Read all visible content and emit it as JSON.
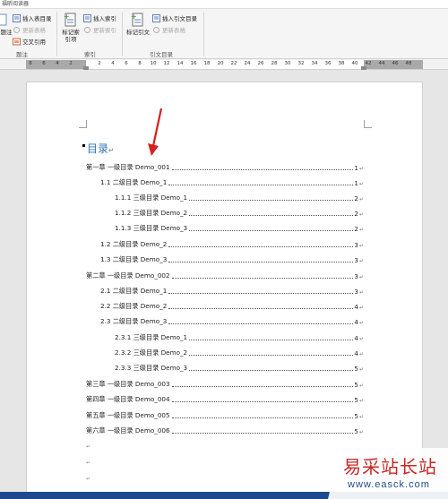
{
  "ribbon": {
    "tab_label": "福昕阅读器",
    "left_cut_label": "题注",
    "groups": {
      "caption_label": "题注",
      "index_label": "索引",
      "citation_label": "引文目录"
    },
    "buttons": {
      "insert_table_of_figures": "插入表目录",
      "update_table": "更新表格",
      "cross_reference": "交叉引用",
      "mark_entry": "标记索引项",
      "insert_index": "插入索引",
      "update_index": "更新索引",
      "mark_citation": "标记引文",
      "insert_table_of_authorities": "插入引文目录",
      "update_table_auth": "更新表格"
    }
  },
  "ruler": {
    "ticks": [
      "8",
      "6",
      "4",
      "2",
      "2",
      "4",
      "6",
      "8",
      "10",
      "12",
      "14",
      "16",
      "18",
      "20",
      "22",
      "24",
      "26",
      "28",
      "30",
      "32",
      "34",
      "36",
      "38",
      "40",
      "42",
      "44",
      "46",
      "48"
    ]
  },
  "document": {
    "toc_title": "目录",
    "paragraph_mark": "↵",
    "entries": [
      {
        "text": "第一章  一级目录 Demo_001",
        "page": "1"
      },
      {
        "text": "1.1  二级目录 Demo_1",
        "page": "1"
      },
      {
        "text": "1.1.1  三级目录 Demo_1",
        "page": "2"
      },
      {
        "text": "1.1.2  三级目录 Demo_2",
        "page": "2"
      },
      {
        "text": "1.1.3  三级目录 Demo_3",
        "page": "2"
      },
      {
        "text": "1.2  二级目录 Demo_2",
        "page": "3"
      },
      {
        "text": "1.3  二级目录 Demo_3",
        "page": "3"
      },
      {
        "text": "第二章  一级目录 Demo_002",
        "page": "3"
      },
      {
        "text": "2.1  二级目录 Demo_1",
        "page": "3"
      },
      {
        "text": "2.2  二级目录 Demo_2",
        "page": "4"
      },
      {
        "text": "2.3  二级目录 Demo_3",
        "page": "4"
      },
      {
        "text": "2.3.1  三级目录 Demo_1",
        "page": "4"
      },
      {
        "text": "2.3.2  三级目录 Demo_2",
        "page": "4"
      },
      {
        "text": "2.3.3  三级目录 Demo_3",
        "page": "5"
      },
      {
        "text": "第三章  一级目录 Demo_003",
        "page": "5"
      },
      {
        "text": "第四章  一级目录 Demo_004",
        "page": "5"
      },
      {
        "text": "第五章  一级目录 Demo_005",
        "page": "5"
      },
      {
        "text": "第六章  一级目录 Demo_006",
        "page": "5"
      }
    ]
  },
  "watermark": {
    "text": "易采站长站",
    "url": "www.easck.com"
  },
  "colors": {
    "toc_title": "#2e74b5",
    "arrow": "#d62020",
    "watermark_text": "#c62828",
    "bottom_bar": "#1d4a8c"
  }
}
